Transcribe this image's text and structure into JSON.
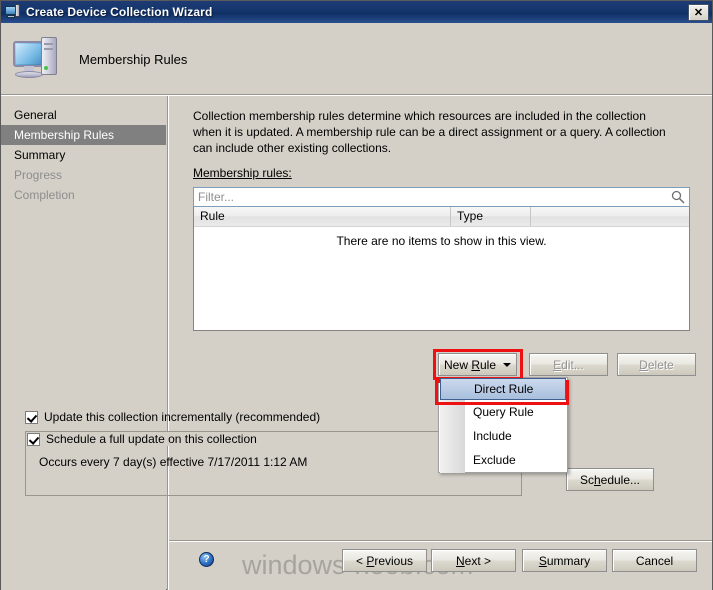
{
  "window": {
    "title": "Create Device Collection Wizard",
    "close_label": "✕",
    "icon": "computer-icon"
  },
  "header": {
    "title": "Membership Rules",
    "icon": "computer-icon"
  },
  "sidebar": {
    "items": [
      {
        "label": "General",
        "state": "normal"
      },
      {
        "label": "Membership Rules",
        "state": "selected"
      },
      {
        "label": "Summary",
        "state": "normal"
      },
      {
        "label": "Progress",
        "state": "disabled"
      },
      {
        "label": "Completion",
        "state": "disabled"
      }
    ]
  },
  "main": {
    "intro": "Collection membership rules determine which resources are included in the collection when it is updated. A membership rule can be a direct assignment or a query. A collection can include other existing collections.",
    "rules_label": "Membership rules:",
    "filter": {
      "placeholder": "Filter...",
      "value": "",
      "icon": "search-icon"
    },
    "listview": {
      "columns": [
        "Rule",
        "Type",
        ""
      ],
      "empty_text": "There are no items to show in this view.",
      "rows": []
    },
    "buttons": {
      "new_rule": "New Rule",
      "new_rule_caret": "chevron-down-icon",
      "edit": "Edit...",
      "delete": "Delete",
      "schedule": "Schedule..."
    },
    "dropdown": {
      "items": [
        {
          "label": "Direct Rule",
          "selected": true
        },
        {
          "label": "Query Rule",
          "selected": false
        },
        {
          "label": "Include",
          "selected": false
        },
        {
          "label": "Exclude",
          "selected": false
        }
      ]
    },
    "checkboxes": {
      "incremental": {
        "label": "Update this collection incrementally (recommended)",
        "checked": true
      },
      "full_update": {
        "label": "Schedule a full update on this collection",
        "checked": true
      }
    },
    "schedule_text": "Occurs every 7 day(s) effective 7/17/2011 1:12 AM"
  },
  "footer": {
    "help_icon": "help-icon",
    "help_glyph": "?",
    "previous": "< Previous",
    "next": "Next >",
    "summary": "Summary",
    "cancel": "Cancel"
  },
  "watermark": "windows-noob.com",
  "colors": {
    "titlebar": "#14366e",
    "face": "#d4d0c8",
    "selection": "#808080",
    "annotation": "#ee1111",
    "menu_highlight": "#a9bfdd"
  }
}
